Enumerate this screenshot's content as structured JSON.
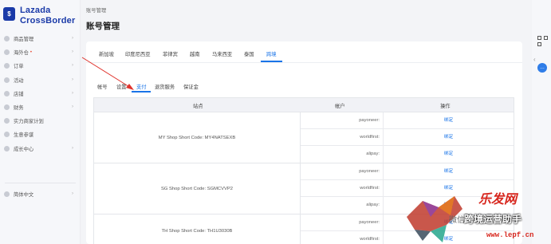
{
  "brand": {
    "name": "Lazada",
    "sub": "CrossBorder",
    "badge": "$"
  },
  "sidebar": {
    "items": [
      {
        "label": "商品管理",
        "chev": "›"
      },
      {
        "label": "海外仓",
        "new": "•",
        "chev": "›"
      },
      {
        "label": "订单",
        "chev": "›"
      },
      {
        "label": "活动",
        "chev": "›"
      },
      {
        "label": "店铺",
        "chev": "›"
      },
      {
        "label": "财务",
        "chev": "›"
      },
      {
        "label": "实力商家计划",
        "chev": ""
      },
      {
        "label": "生意参谋",
        "chev": ""
      },
      {
        "label": "成长中心",
        "chev": "›"
      }
    ],
    "language": {
      "label": "简体中文",
      "chev": "›"
    }
  },
  "header": {
    "breadcrumb": "账号管理",
    "title": "账号管理"
  },
  "country_tabs": [
    "新加坡",
    "印度尼西亚",
    "菲律宾",
    "越南",
    "马来西亚",
    "泰国",
    "跨境"
  ],
  "active_country_tab": "跨境",
  "sub_tabs": [
    "帐号",
    "设置",
    "支付",
    "退货服务",
    "保证金"
  ],
  "active_sub_tab": "支付",
  "table": {
    "headers": {
      "site": "站点",
      "account": "帐户",
      "action": "操作"
    },
    "groups": [
      {
        "site": "MY Shop Short Code: MY4NATSEXB",
        "rows": [
          {
            "account": "payoneer:",
            "action": "绑定"
          },
          {
            "account": "worldfirst:",
            "action": "绑定"
          },
          {
            "account": "alipay:",
            "action": "绑定"
          }
        ]
      },
      {
        "site": "SG Shop Short Code: SGMCVVP2",
        "rows": [
          {
            "account": "payoneer:",
            "action": "绑定"
          },
          {
            "account": "worldfirst:",
            "action": "绑定"
          },
          {
            "account": "alipay:",
            "action": "绑定"
          }
        ]
      },
      {
        "site": "TH Shop Short Code: TH1U3030B",
        "rows": [
          {
            "account": "payoneer:",
            "action": "绑定"
          },
          {
            "account": "worldfirst:",
            "action": "绑定"
          }
        ]
      }
    ]
  },
  "right_strip": {
    "chat": "…",
    "arrow": "‹"
  },
  "watermark": {
    "logo_text": "乐发网",
    "label": "跨境运营助手",
    "url": "www.lepf.cn",
    "wechat": "微信"
  },
  "colors": {
    "accent": "#1a74e8",
    "brand": "#1a3aa8",
    "arrow": "#e0322b"
  }
}
